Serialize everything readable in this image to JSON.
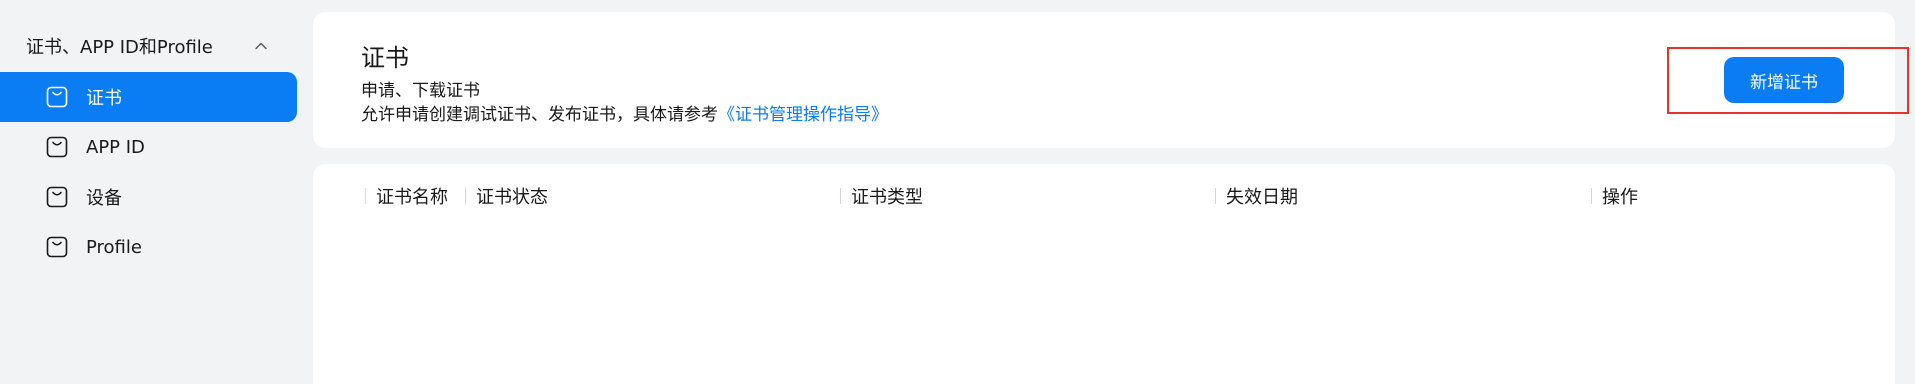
{
  "sidebar": {
    "group_label": "证书、APP ID和Profile",
    "items": [
      {
        "label": "证书",
        "active": true
      },
      {
        "label": "APP ID",
        "active": false
      },
      {
        "label": "设备",
        "active": false
      },
      {
        "label": "Profile",
        "active": false
      }
    ],
    "icon": "bag-icon",
    "chevron_icon": "chevron-up-icon"
  },
  "header": {
    "title": "证书",
    "subtitle": "申请、下载证书",
    "description_prefix": "允许申请创建调试证书、发布证书，具体请参考",
    "guide_link": "《证书管理操作指导》",
    "add_button_label": "新增证书"
  },
  "table": {
    "columns": [
      "证书名称",
      "证书状态",
      "证书类型",
      "失效日期",
      "操作"
    ],
    "rows": []
  },
  "colors": {
    "accent": "#0a7cf4",
    "highlight": "#e8322e",
    "background": "#f1f3f5"
  }
}
